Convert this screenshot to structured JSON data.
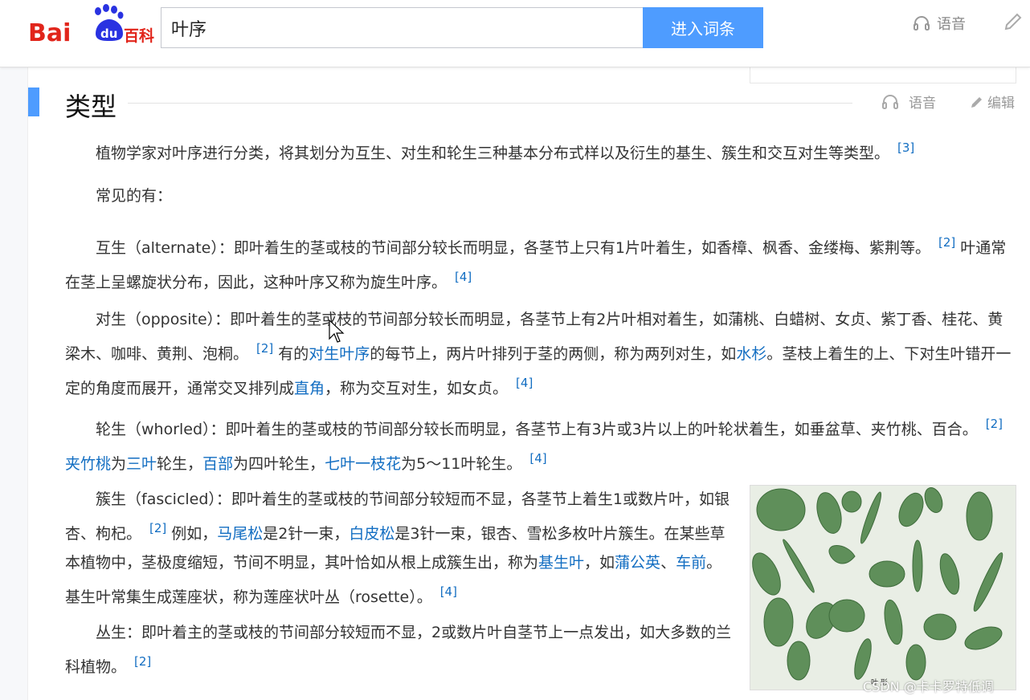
{
  "header": {
    "search_value": "叶序",
    "enter_button": "进入词条",
    "voice_label": "语音"
  },
  "section": {
    "title": "类型",
    "voice_label": "语音",
    "edit_label": "编辑"
  },
  "paragraphs": {
    "p1": {
      "text": "植物学家对叶序进行分类，将其划分为互生、对生和轮生三种基本分布式样以及衍生的基生、簇生和交互对生等类型。",
      "ref": "[3]"
    },
    "p2": {
      "text": "常见的有："
    },
    "p3": {
      "t1": "互生（alternate）：即叶着生的茎或枝的节间部分较长而明显，各茎节上只有1片叶着生，如香樟、枫香、金缕梅、紫荆等。",
      "ref1": "[2]",
      "t2": "叶通常在茎上呈螺旋状分布，因此，这种叶序又称为旋生叶序。",
      "ref2": "[4]"
    },
    "p4": {
      "t1": "对生（opposite）：即叶着生的茎或枝的节间部分较长而明显，各茎节上有2片叶相对着生，如蒲桃、白蜡树、女贞、紫丁香、桂花、黄梁木、咖啡、黄荆、泡桐。",
      "ref1": "[2]",
      "t2": "有的",
      "link1": "对生叶序",
      "t3": "的每节上，两片叶排列于茎的两侧，称为两列对生，如",
      "link2": "水杉",
      "t4": "。茎枝上着生的上、下对生叶错开一定的角度而展开，通常交叉排列成",
      "link3": "直角",
      "t5": "，称为交互对生，如女贞。",
      "ref2": "[4]"
    },
    "p5": {
      "t1": "轮生（whorled）：即叶着生的茎或枝的节间部分较长而明显，各茎节上有3片或3片以上的叶轮状着生，如垂盆草、夹竹桃、百合。",
      "ref1": "[2]",
      "link1": "夹竹桃",
      "t2": "为",
      "link2": "三叶",
      "t3": "轮生，",
      "link3": "百部",
      "t4": "为四叶轮生，",
      "link4": "七叶一枝花",
      "t5": "为5～11叶轮生。",
      "ref2": "[4]"
    },
    "p6": {
      "t1": "簇生（fascicled）：即叶着生的茎或枝的节间部分较短而不显，各茎节上着生1或数片叶，如银杏、枸杞。",
      "ref1": "[2]",
      "t2": "例如，",
      "link1": "马尾松",
      "t3": "是2针一束，",
      "link2": "白皮松",
      "t4": "是3针一束，银杏、雪松多枚叶片簇生。在某些草本植物中，茎极度缩短，节间不明显，其叶恰如从根上成簇生出，称为",
      "link3": "基生叶",
      "t5": "，如",
      "link4": "蒲公英",
      "t6": "、",
      "link5": "车前",
      "t7": "。基生叶常集生成莲座状，称为莲座状叶丛（rosette）。",
      "ref2": "[4]"
    },
    "p7": {
      "t1": "丛生：即叶着主的茎或枝的节间部分较短而不显，2或数片叶自茎节上一点发出，如大多数的兰科植物。",
      "ref1": "[2]"
    }
  },
  "figure": {
    "caption": "叶 形"
  },
  "watermark": "CSDN @卡卡罗特低调",
  "colors": {
    "accent": "#4e9cff",
    "link": "#136ec2",
    "logo_red": "#e1251b",
    "logo_blue": "#2932e1"
  }
}
